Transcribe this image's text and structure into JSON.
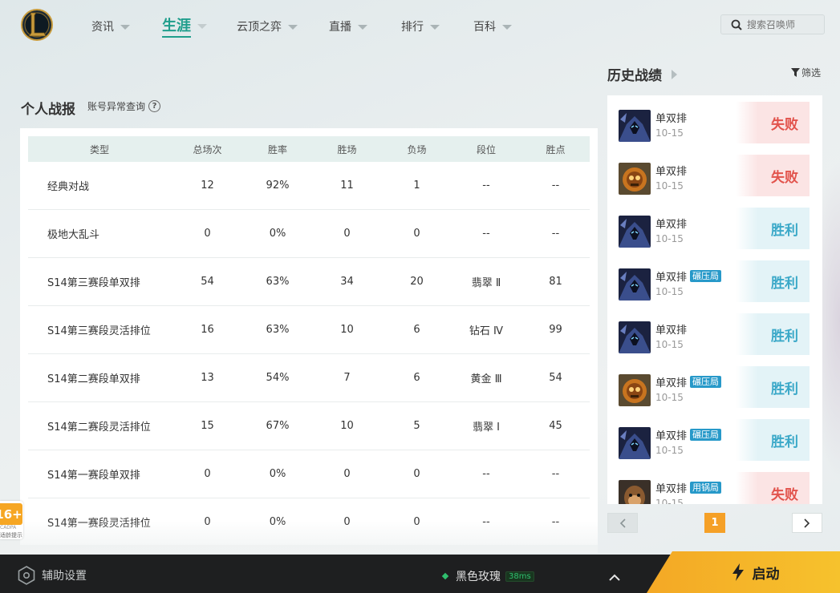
{
  "nav": {
    "items": [
      {
        "label": "资讯",
        "active": false
      },
      {
        "label": "生涯",
        "active": true
      },
      {
        "label": "云顶之弈",
        "active": false
      },
      {
        "label": "直播",
        "active": false
      },
      {
        "label": "排行",
        "active": false
      },
      {
        "label": "百科",
        "active": false
      }
    ],
    "search_placeholder": "搜索召唤师"
  },
  "stats": {
    "title": "个人战报",
    "link": "账号异常查询",
    "headers": [
      "类型",
      "总场次",
      "胜率",
      "胜场",
      "负场",
      "段位",
      "胜点"
    ],
    "rows": [
      [
        "经典对战",
        "12",
        "92%",
        "11",
        "1",
        "--",
        "--"
      ],
      [
        "极地大乱斗",
        "0",
        "0%",
        "0",
        "0",
        "--",
        "--"
      ],
      [
        "S14第三赛段单双排",
        "54",
        "63%",
        "34",
        "20",
        "翡翠 Ⅱ",
        "81"
      ],
      [
        "S14第三赛段灵活排位",
        "16",
        "63%",
        "10",
        "6",
        "钻石 Ⅳ",
        "99"
      ],
      [
        "S14第二赛段单双排",
        "13",
        "54%",
        "7",
        "6",
        "黄金 Ⅲ",
        "54"
      ],
      [
        "S14第二赛段灵活排位",
        "15",
        "67%",
        "10",
        "5",
        "翡翠 Ⅰ",
        "45"
      ],
      [
        "S14第一赛段单双排",
        "0",
        "0%",
        "0",
        "0",
        "--",
        "--"
      ],
      [
        "S14第一赛段灵活排位",
        "0",
        "0%",
        "0",
        "0",
        "--",
        "--"
      ]
    ]
  },
  "age_badge": {
    "num": "16+",
    "line1": "CADPA",
    "line2": "适龄提示"
  },
  "history": {
    "title": "历史战绩",
    "filter": "筛选",
    "matches": [
      {
        "mode": "单双排",
        "tag": "",
        "date": "10-15",
        "result": "失败",
        "win": false,
        "champ": "dark"
      },
      {
        "mode": "单双排",
        "tag": "",
        "date": "10-15",
        "result": "失败",
        "win": false,
        "champ": "orange"
      },
      {
        "mode": "单双排",
        "tag": "",
        "date": "10-15",
        "result": "胜利",
        "win": true,
        "champ": "dark"
      },
      {
        "mode": "单双排",
        "tag": "碾压局",
        "date": "10-15",
        "result": "胜利",
        "win": true,
        "champ": "dark"
      },
      {
        "mode": "单双排",
        "tag": "",
        "date": "10-15",
        "result": "胜利",
        "win": true,
        "champ": "dark"
      },
      {
        "mode": "单双排",
        "tag": "碾压局",
        "date": "10-15",
        "result": "胜利",
        "win": true,
        "champ": "orange"
      },
      {
        "mode": "单双排",
        "tag": "碾压局",
        "date": "10-15",
        "result": "胜利",
        "win": true,
        "champ": "dark"
      },
      {
        "mode": "单双排",
        "tag": "用锅局",
        "date": "10-15",
        "result": "失败",
        "win": false,
        "champ": "brown"
      }
    ],
    "page": "1"
  },
  "bottom": {
    "assist": "辅助设置",
    "server": "黑色玫瑰",
    "ping": "38ms",
    "launch": "启动"
  }
}
